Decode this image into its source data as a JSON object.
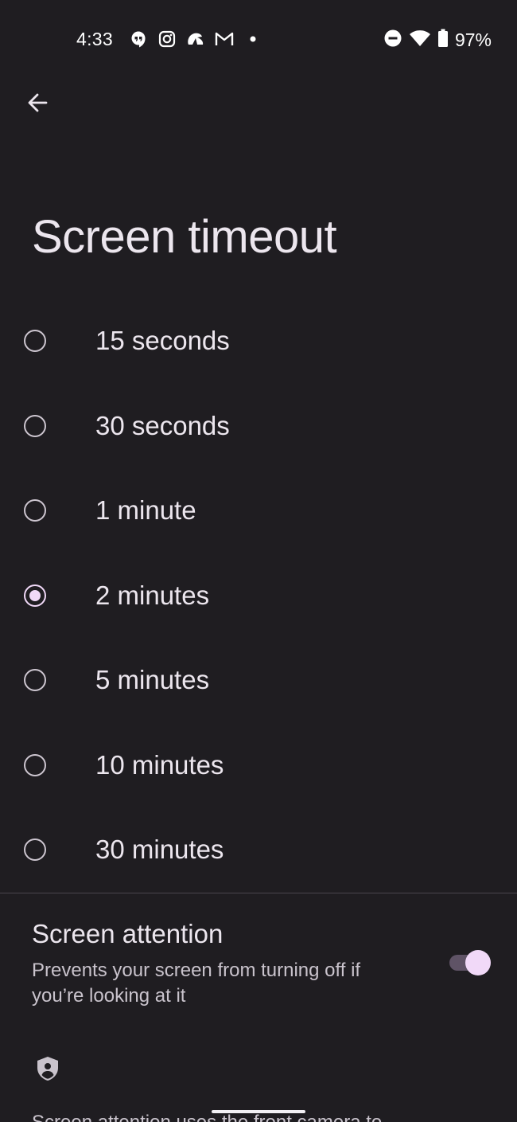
{
  "status_bar": {
    "time": "4:33",
    "battery": "97%",
    "notification_icons": [
      "hangouts-icon",
      "instagram-icon",
      "cloud-icon",
      "gmail-icon",
      "more-dot-icon"
    ],
    "system_icons": [
      "do-not-disturb-icon",
      "wifi-icon",
      "battery-icon"
    ]
  },
  "header": {
    "back_icon": "back-arrow-icon",
    "title": "Screen timeout"
  },
  "timeout_options": [
    {
      "label": "15 seconds",
      "selected": false
    },
    {
      "label": "30 seconds",
      "selected": false
    },
    {
      "label": "1 minute",
      "selected": false
    },
    {
      "label": "2 minutes",
      "selected": true
    },
    {
      "label": "5 minutes",
      "selected": false
    },
    {
      "label": "10 minutes",
      "selected": false
    },
    {
      "label": "30 minutes",
      "selected": false
    }
  ],
  "screen_attention": {
    "title": "Screen attention",
    "summary": "Prevents your screen from turning off if you’re looking at it",
    "enabled": true,
    "footer_icon": "privacy-shield-icon",
    "footer_text_partial": "Screen attention uses the front camera to"
  },
  "colors": {
    "background": "#1f1d21",
    "accent": "#f1d9f8",
    "toggle_track": "#5f5366",
    "text_primary": "#ece6ee",
    "text_secondary": "#c9c3cc"
  }
}
